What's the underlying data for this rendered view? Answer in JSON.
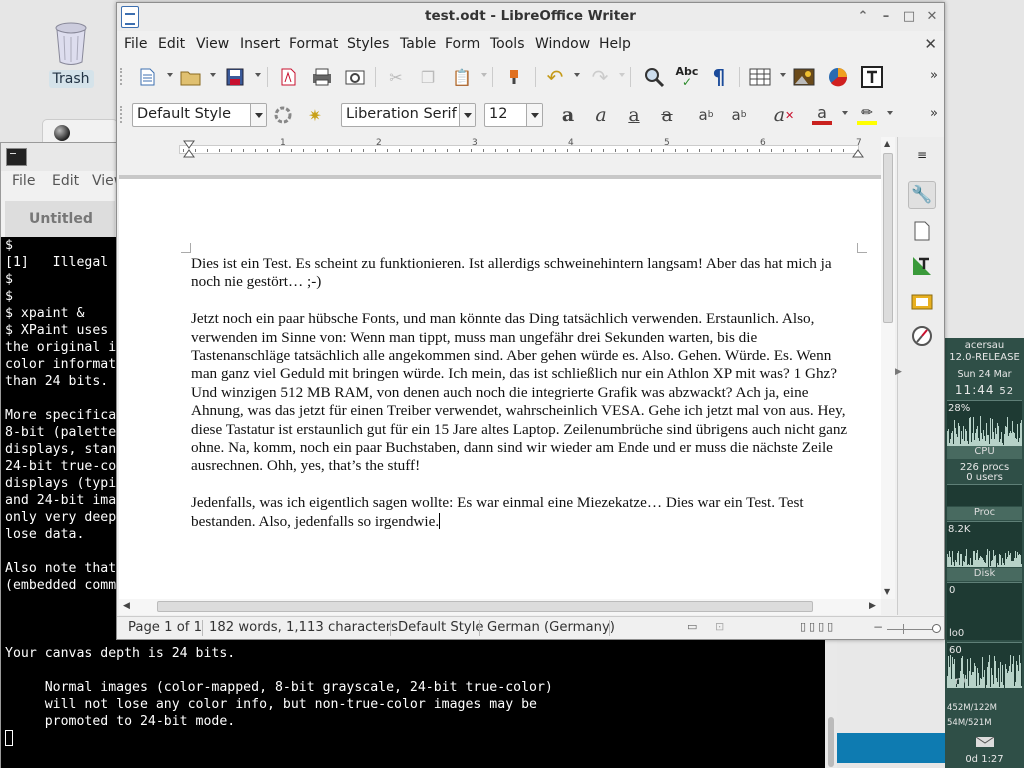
{
  "desktop": {
    "trash_label": "Trash"
  },
  "terminal": {
    "menus": [
      "File",
      "Edit",
      "View"
    ],
    "tab_title": "Untitled",
    "lines": [
      "$",
      "[1]   Illegal",
      "$",
      "$",
      "$ xpaint &",
      "$ XPaint uses",
      "the original i",
      "color informat",
      "than 24 bits.",
      "",
      "More specifica",
      "8-bit (palette",
      "displays, stan",
      "24-bit true-co",
      "displays (typi",
      "and 24-bit ima",
      "only very deep",
      "lose data.",
      "",
      "Also note that",
      "(embedded comm",
      "",
      "",
      "",
      "Your canvas depth is 24 bits.",
      "",
      "     Normal images (color-mapped, 8-bit grayscale, 24-bit true-color)",
      "     will not lose any color info, but non-true-color images may be",
      "     promoted to 24-bit mode."
    ]
  },
  "monitor": {
    "user": "acersau",
    "release": "12.0-RELEASE",
    "date": "Sun 24 Mar",
    "time": "11:44",
    "seconds": "52",
    "cpu_pct": "28%",
    "cpu_label": "CPU",
    "procs": "226 procs",
    "users": "0 users",
    "proc_label": "Proc",
    "proc_val": "8.2K",
    "disk_label": "Disk",
    "disk_val": "0",
    "io_label": "lo0",
    "net_val": "60",
    "vr_label": "vr0",
    "mem1": "452M/122M",
    "mem2": "54M/521M",
    "uptime": "0d 1:27"
  },
  "writer": {
    "window_title": "test.odt - LibreOffice Writer",
    "menu": [
      "File",
      "Edit",
      "View",
      "Insert",
      "Format",
      "Styles",
      "Table",
      "Form",
      "Tools",
      "Window",
      "Help"
    ],
    "paragraph_style": "Default Style",
    "font_name": "Liberation Serif",
    "font_size": "12",
    "ruler_numbers": [
      "1",
      "2",
      "3",
      "4",
      "5",
      "6",
      "7"
    ],
    "paragraphs": [
      "Dies ist ein Test. Es scheint zu funktionieren. Ist allerdigs schweinehintern langsam! Aber das hat mich ja noch nie gestört… ;-)",
      "Jetzt noch ein paar hübsche Fonts, und man könnte das Ding tatsächlich verwenden. Erstaunlich. Also, verwenden im Sinne von: Wenn man tippt, muss man ungefähr drei Sekunden warten, bis die Tastenanschläge tatsächlich alle angekommen sind. Aber gehen würde es. Also. Gehen. Würde. Es. Wenn man ganz viel Geduld mit bringen würde. Ich mein, das ist schließlich nur ein Athlon XP mit was? 1 Ghz? Und winzigen 512 MB RAM, von denen auch noch die integrierte Grafik was abzwackt? Ach ja, eine Ahnung, was das jetzt für einen Treiber verwendet, wahrscheinlich VESA. Gehe ich jetzt mal von aus. Hey, diese Tastatur ist erstaunlich gut für ein 15 Jare altes Laptop. Zeilenumbrüche sind übrigens auch nicht ganz ohne. Na, komm, noch ein paar Buchstaben, dann sind wir wieder am Ende und er muss die nächste Zeile ausrechnen. Ohh, yes, that’s the stuff!",
      "Jedenfalls, was ich eigentlich sagen wollte: Es war einmal eine Miezekatze… Dies war ein Test. Test bestanden. Also, jedenfalls so irgendwie."
    ],
    "status": {
      "page": "Page 1 of 1",
      "words": "182 words, 1,113 characters",
      "style": "Default Style",
      "language": "German (Germany)"
    }
  },
  "colors": {
    "font_color": "#c9211e",
    "highlight": "#ffff00",
    "monitor_bg": "#2f4f47"
  }
}
